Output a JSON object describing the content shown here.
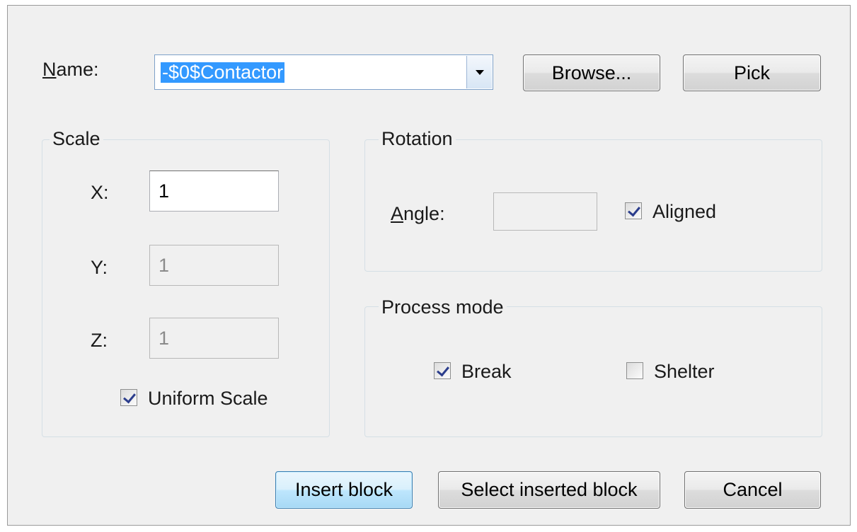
{
  "name_row": {
    "label_underline": "N",
    "label_rest": "ame:",
    "value": "-$0$Contactor",
    "browse_label": "Browse...",
    "pick_label": "Pick"
  },
  "scale": {
    "title": "Scale",
    "x_label": "X:",
    "x_value": "1",
    "y_label": "Y:",
    "y_value": "1",
    "z_label": "Z:",
    "z_value": "1",
    "uniform_label": "Uniform Scale",
    "uniform_checked": true
  },
  "rotation": {
    "title": "Rotation",
    "angle_underline": "A",
    "angle_rest": "ngle:",
    "angle_value": "",
    "aligned_label": "Aligned",
    "aligned_checked": true
  },
  "process_mode": {
    "title": "Process mode",
    "break_label": "Break",
    "break_checked": true,
    "shelter_label": "Shelter",
    "shelter_checked": false
  },
  "actions": {
    "insert_label": "Insert block",
    "select_label": "Select inserted block",
    "cancel_label": "Cancel"
  },
  "colors": {
    "selection": "#3399ff",
    "dialog_bg": "#f0f0f0",
    "default_button_border": "#3c7fb1"
  }
}
